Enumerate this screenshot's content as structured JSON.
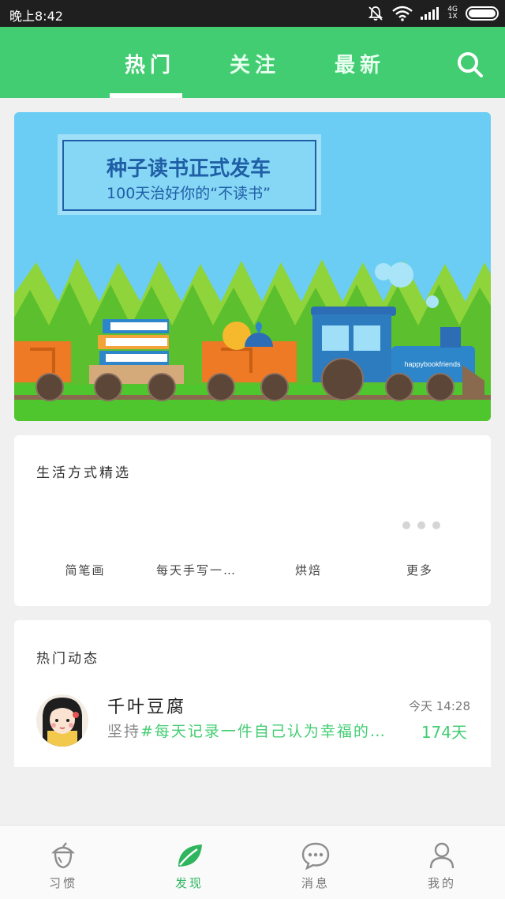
{
  "status_bar": {
    "time": "晚上8:42",
    "network_top": "4G",
    "network_bottom": "1X"
  },
  "top_tabs": [
    {
      "label": "热门",
      "active": true
    },
    {
      "label": "关注",
      "active": false
    },
    {
      "label": "最新",
      "active": false
    }
  ],
  "banner": {
    "title": "种子读书正式发车",
    "subtitle": "100天治好你的“不读书”",
    "train_text": "happybookfriends"
  },
  "lifestyle": {
    "title": "生活方式精选",
    "items": [
      "简笔画",
      "每天手写一…",
      "烘焙",
      "更多"
    ]
  },
  "trending": {
    "title": "热门动态",
    "post": {
      "user": "千叶豆腐",
      "time": "今天 14:28",
      "lead": "坚持",
      "habit": "#每天记录一件自己认为幸福的…",
      "days": "174天"
    }
  },
  "bottom_nav": [
    {
      "label": "习惯",
      "icon": "acorn-icon",
      "active": false
    },
    {
      "label": "发现",
      "icon": "leaf-icon",
      "active": true
    },
    {
      "label": "消息",
      "icon": "chat-bubble-icon",
      "active": false
    },
    {
      "label": "我的",
      "icon": "person-icon",
      "active": false
    }
  ],
  "colors": {
    "brand_green": "#43cd72",
    "status_bar": "#1f1f1f",
    "banner_sky": "#6ccdf4"
  }
}
